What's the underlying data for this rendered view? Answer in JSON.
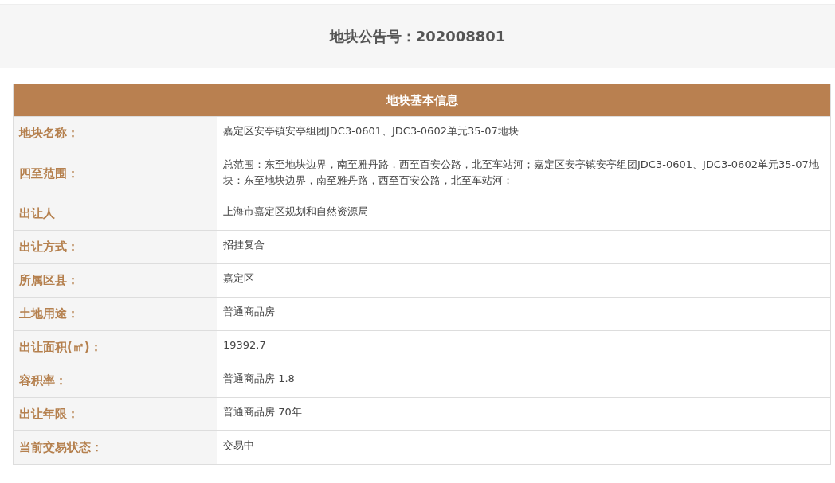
{
  "notice_title": "地块公告号：202008801",
  "table": {
    "title": "地块基本信息",
    "rows": [
      {
        "label": "地块名称：",
        "value": "嘉定区安亭镇安亭组团JDC3-0601、JDC3-0602单元35-07地块"
      },
      {
        "label": "四至范围：",
        "value": "总范围：东至地块边界，南至雅丹路，西至百安公路，北至车站河；嘉定区安亭镇安亭组团JDC3-0601、JDC3-0602单元35-07地块：东至地块边界，南至雅丹路，西至百安公路，北至车站河；"
      },
      {
        "label": "出让人",
        "value": "上海市嘉定区规划和自然资源局"
      },
      {
        "label": "出让方式：",
        "value": "招挂复合"
      },
      {
        "label": "所属区县：",
        "value": "嘉定区"
      },
      {
        "label": "土地用途：",
        "value": "普通商品房"
      },
      {
        "label": "出让面积(㎡)：",
        "value": "19392.7"
      },
      {
        "label": "容积率：",
        "value": "普通商品房 1.8"
      },
      {
        "label": "出让年限：",
        "value": "普通商品房 70年"
      },
      {
        "label": "当前交易状态：",
        "value": "交易中"
      }
    ]
  }
}
